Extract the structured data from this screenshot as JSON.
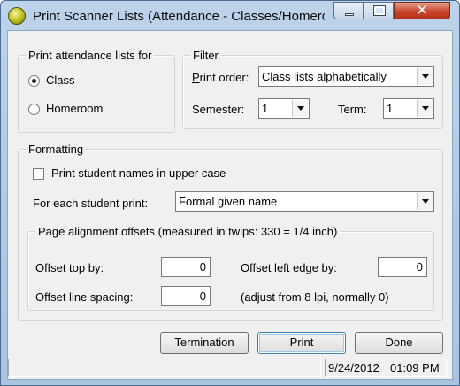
{
  "window": {
    "title": "Print Scanner Lists (Attendance - Classes/Homero...",
    "controls": [
      "minimize-icon",
      "maximize-icon",
      "close-icon"
    ]
  },
  "attendance_group": {
    "legend": "Print attendance lists for",
    "options": [
      {
        "label": "Class",
        "selected": true
      },
      {
        "label": "Homeroom",
        "selected": false
      }
    ]
  },
  "filter_group": {
    "legend": "Filter",
    "print_order_label": "Print order:",
    "print_order_value": "Class lists alphabetically",
    "semester_label": "Semester:",
    "semester_value": "1",
    "term_label": "Term:",
    "term_value": "1"
  },
  "formatting_group": {
    "legend": "Formatting",
    "upper_case_label": "Print student names in upper case",
    "upper_case_checked": false,
    "for_each_label": "For each student print:",
    "for_each_value": "Formal given name",
    "alignment": {
      "legend": "Page alignment offsets  (measured in twips: 330 = 1/4 inch)",
      "offset_top_label": "Offset top by:",
      "offset_top_value": "0",
      "offset_left_label": "Offset left edge by:",
      "offset_left_value": "0",
      "offset_line_label": "Offset line spacing:",
      "offset_line_value": "0",
      "line_note": "(adjust from 8 lpi, normally 0)"
    }
  },
  "buttons": {
    "termination": "Termination",
    "print": "Print",
    "done": "Done"
  },
  "status": {
    "message": "",
    "date": "9/24/2012",
    "time": "01:09 PM"
  }
}
